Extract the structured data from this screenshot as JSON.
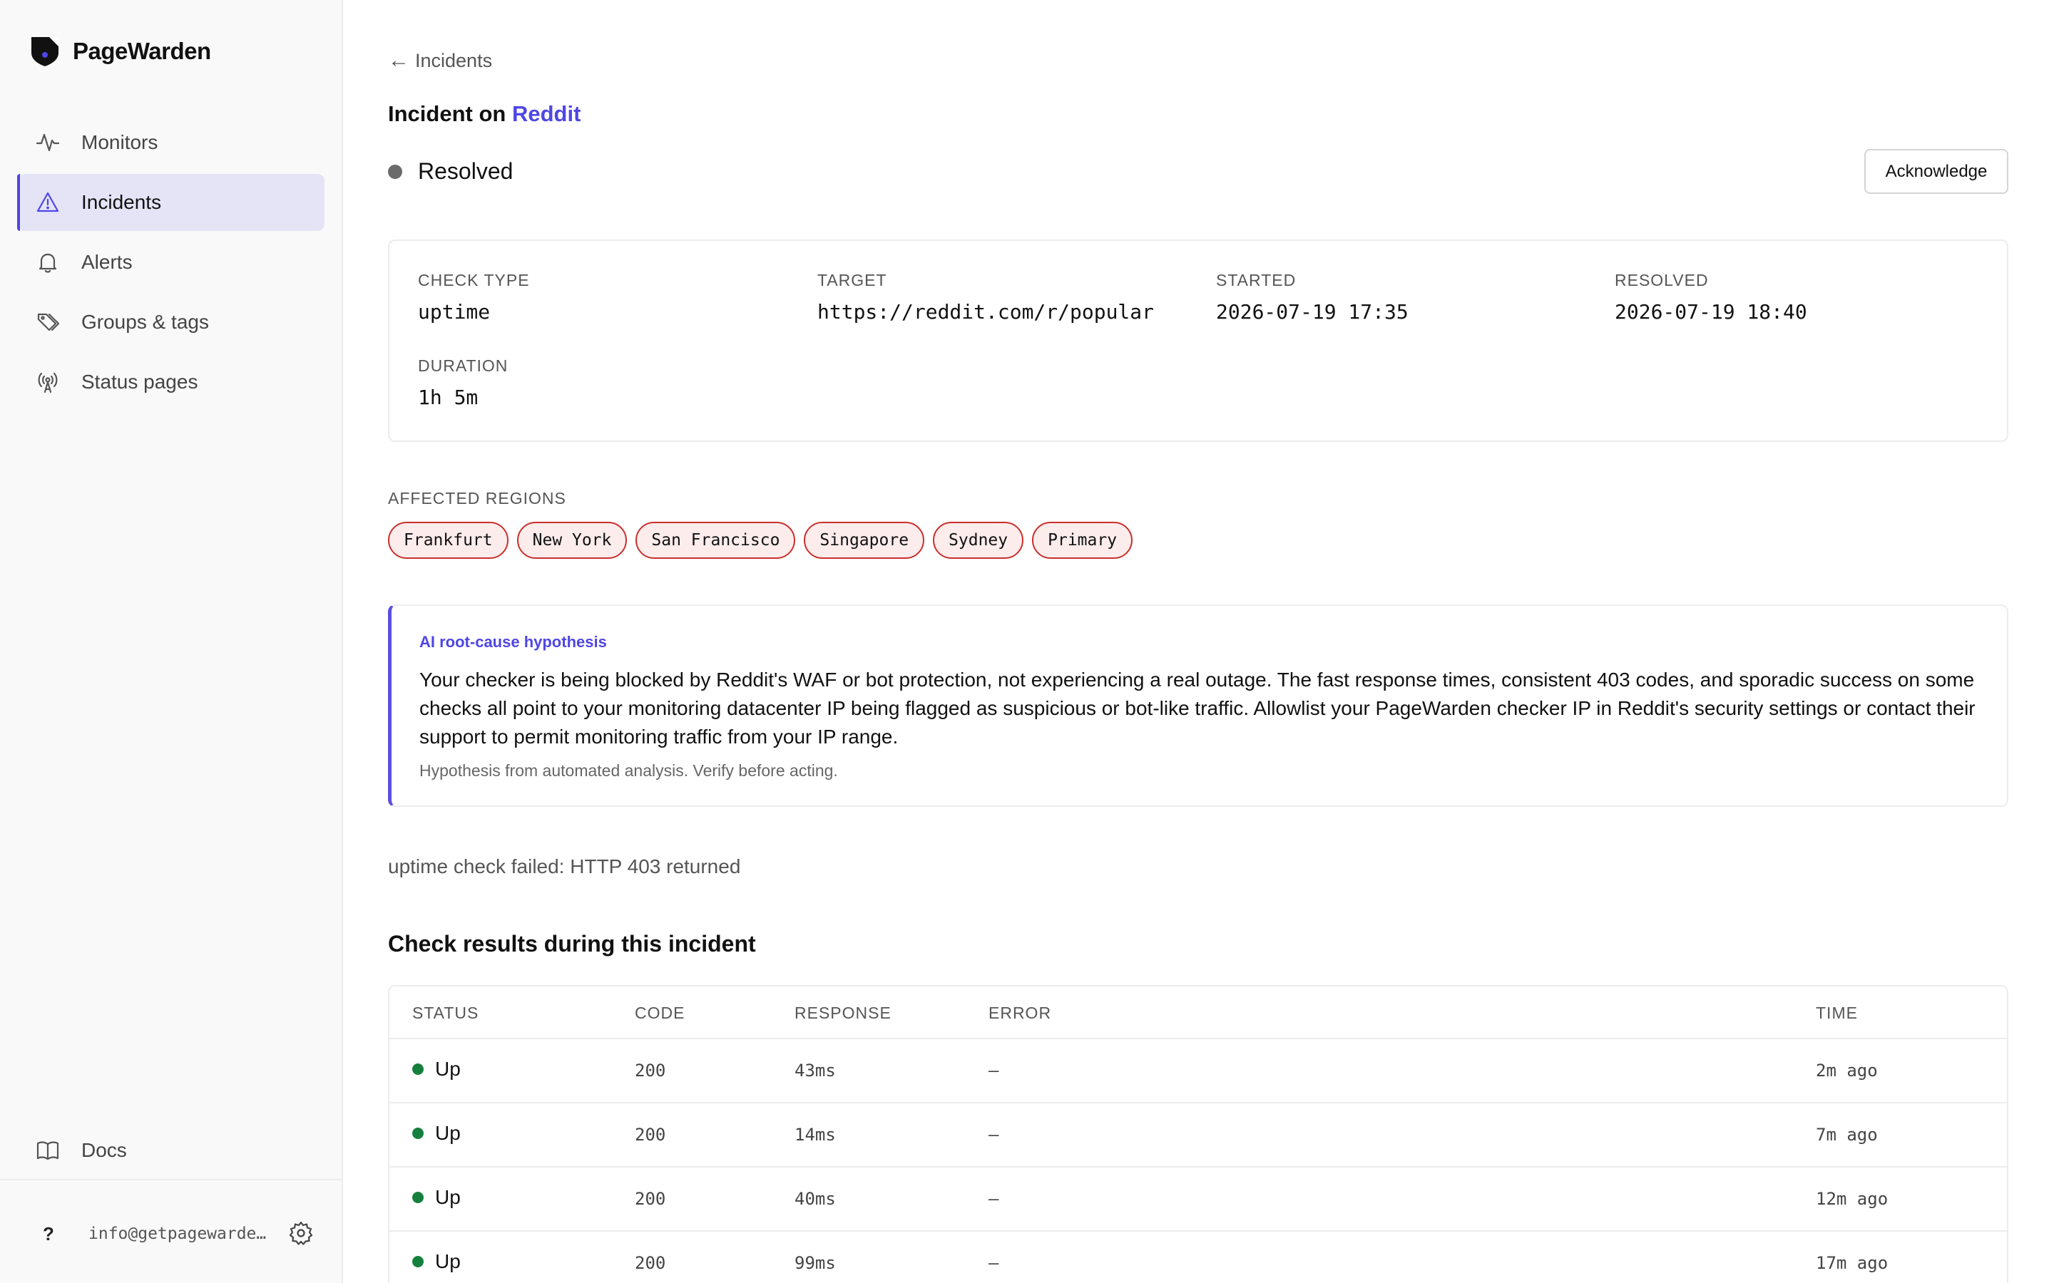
{
  "app": {
    "name": "PageWarden"
  },
  "sidebar": {
    "items": [
      {
        "label": "Monitors",
        "icon": "activity-icon",
        "active": false
      },
      {
        "label": "Incidents",
        "icon": "warning-triangle-icon",
        "active": true
      },
      {
        "label": "Alerts",
        "icon": "bell-icon",
        "active": false
      },
      {
        "label": "Groups & tags",
        "icon": "tag-icon",
        "active": false
      },
      {
        "label": "Status pages",
        "icon": "broadcast-icon",
        "active": false
      }
    ],
    "docs": {
      "label": "Docs",
      "icon": "book-icon"
    },
    "footer": {
      "help": "?",
      "email": "info@getpagewarden.com",
      "settings_icon": "gear-icon"
    }
  },
  "page": {
    "back_label": "Incidents",
    "title_prefix": "Incident on",
    "monitor_name": "Reddit",
    "status": "Resolved",
    "acknowledge_label": "Acknowledge"
  },
  "details": {
    "check_type": {
      "label": "CHECK TYPE",
      "value": "uptime"
    },
    "target": {
      "label": "TARGET",
      "value": "https://reddit.com/r/popular"
    },
    "started": {
      "label": "STARTED",
      "value": "2026-07-19 17:35"
    },
    "resolved": {
      "label": "RESOLVED",
      "value": "2026-07-19 18:40"
    },
    "duration": {
      "label": "DURATION",
      "value": "1h 5m"
    }
  },
  "regions": {
    "label": "AFFECTED REGIONS",
    "items": [
      "Frankfurt",
      "New York",
      "San Francisco",
      "Singapore",
      "Sydney",
      "Primary"
    ]
  },
  "ai": {
    "label": "AI root-cause hypothesis",
    "body": "Your checker is being blocked by Reddit's WAF or bot protection, not experiencing a real outage. The fast response times, consistent 403 codes, and sporadic success on some checks all point to your monitoring datacenter IP being flagged as suspicious or bot-like traffic. Allowlist your PageWarden checker IP in Reddit's security settings or contact their support to permit monitoring traffic from your IP range.",
    "note": "Hypothesis from automated analysis. Verify before acting."
  },
  "failure_message": "uptime check failed: HTTP 403 returned",
  "results": {
    "title": "Check results during this incident",
    "columns": {
      "status": "STATUS",
      "code": "CODE",
      "response": "RESPONSE",
      "error": "ERROR",
      "time": "TIME"
    },
    "rows": [
      {
        "status": "Up",
        "code": "200",
        "response": "43ms",
        "error": "—",
        "time": "2m ago"
      },
      {
        "status": "Up",
        "code": "200",
        "response": "14ms",
        "error": "—",
        "time": "7m ago"
      },
      {
        "status": "Up",
        "code": "200",
        "response": "40ms",
        "error": "—",
        "time": "12m ago"
      },
      {
        "status": "Up",
        "code": "200",
        "response": "99ms",
        "error": "—",
        "time": "17m ago"
      }
    ]
  },
  "colors": {
    "accent": "#4f46e5",
    "status_resolved": "#6b6b6b",
    "status_up": "#15803d",
    "region_border": "#c9302c",
    "region_bg": "#fdecec"
  }
}
